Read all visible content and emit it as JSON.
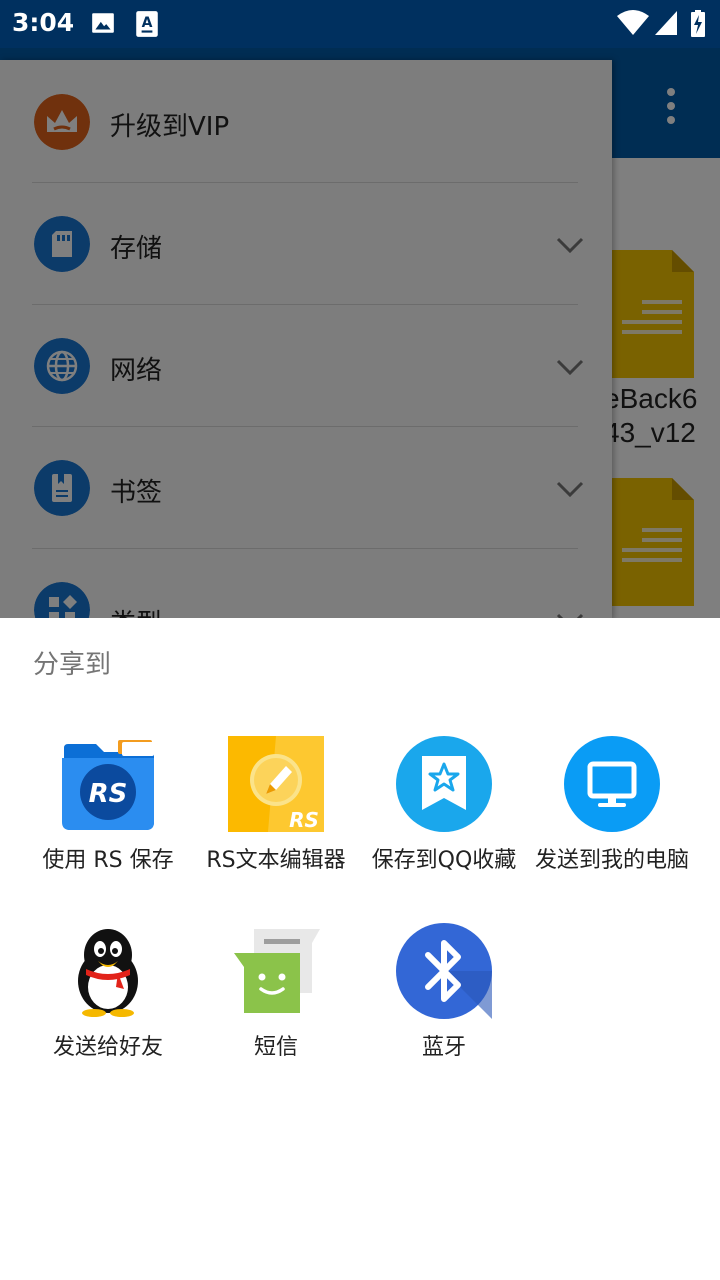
{
  "status_bar": {
    "time": "3:04",
    "icons": [
      "image-notification-icon",
      "font-notification-icon",
      "wifi-icon",
      "signal-icon",
      "battery-charging-icon"
    ]
  },
  "background_app": {
    "drawer_items": [
      {
        "label": "升级到VIP",
        "icon": "crown-icon",
        "icon_color": "#e0621a"
      },
      {
        "label": "存储",
        "icon": "sd-card-icon",
        "icon_color": "#1976d2"
      },
      {
        "label": "网络",
        "icon": "globe-icon",
        "icon_color": "#1976d2"
      },
      {
        "label": "书签",
        "icon": "bookmark-icon",
        "icon_color": "#1976d2"
      },
      {
        "label": "类型",
        "icon": "category-icon",
        "icon_color": "#1976d2"
      }
    ],
    "file_names": [
      "eBack6",
      "43_v12"
    ]
  },
  "share_sheet": {
    "title": "分享到",
    "targets": [
      {
        "label": "使用 RS 保存",
        "icon": "rs-folder-icon"
      },
      {
        "label": "RS文本编辑器",
        "icon": "rs-text-editor-icon"
      },
      {
        "label": "保存到QQ收藏",
        "icon": "qq-favorites-icon"
      },
      {
        "label": "发送到我的电脑",
        "icon": "computer-icon"
      },
      {
        "label": "发送给好友",
        "icon": "qq-penguin-icon"
      },
      {
        "label": "短信",
        "icon": "sms-icon"
      },
      {
        "label": "蓝牙",
        "icon": "bluetooth-icon"
      }
    ]
  },
  "colors": {
    "status_bar": "#00305f",
    "toolbar": "#005aa6",
    "accent_blue": "#1976d2",
    "vip_orange": "#e0621a",
    "file_yellow": "#f5c400"
  }
}
